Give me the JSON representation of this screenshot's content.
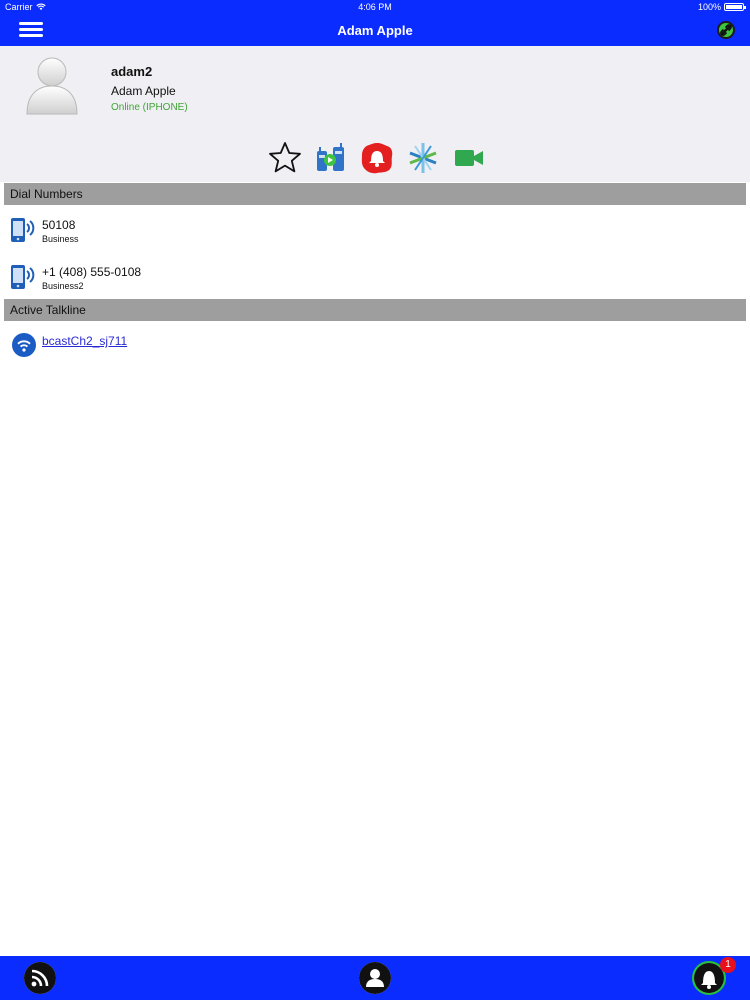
{
  "status_bar": {
    "carrier": "Carrier",
    "time": "4:06 PM",
    "battery": "100%",
    "battery_level": 1.0
  },
  "nav": {
    "title": "Adam Apple",
    "menu_icon": "hamburger-menu-icon",
    "right_icon": "link-icon"
  },
  "profile": {
    "username": "adam2",
    "full_name": "Adam Apple",
    "status": "Online (IPHONE)",
    "status_color": "#3fa535",
    "actions": [
      "favorite-star-icon",
      "walkie-talkie-icon",
      "alert-bell-icon",
      "jabber-icon",
      "video-call-icon"
    ]
  },
  "dial_numbers": {
    "header": "Dial Numbers",
    "items": [
      {
        "number": "50108",
        "type": "Business"
      },
      {
        "number": "+1 (408) 555-0108",
        "type": "Business2"
      }
    ]
  },
  "active_talkline": {
    "header": "Active Talkline",
    "channel": "bcastCh2_sj711"
  },
  "tab_bar": {
    "tabs": [
      "feed-icon",
      "contacts-icon",
      "notifications-icon"
    ],
    "notification_badge": "1"
  },
  "colors": {
    "bar": "#0b2cff",
    "profile_bg": "#efeff4",
    "section_header": "#9e9e9e",
    "link": "#2a2ad4",
    "badge": "#e8101c"
  }
}
